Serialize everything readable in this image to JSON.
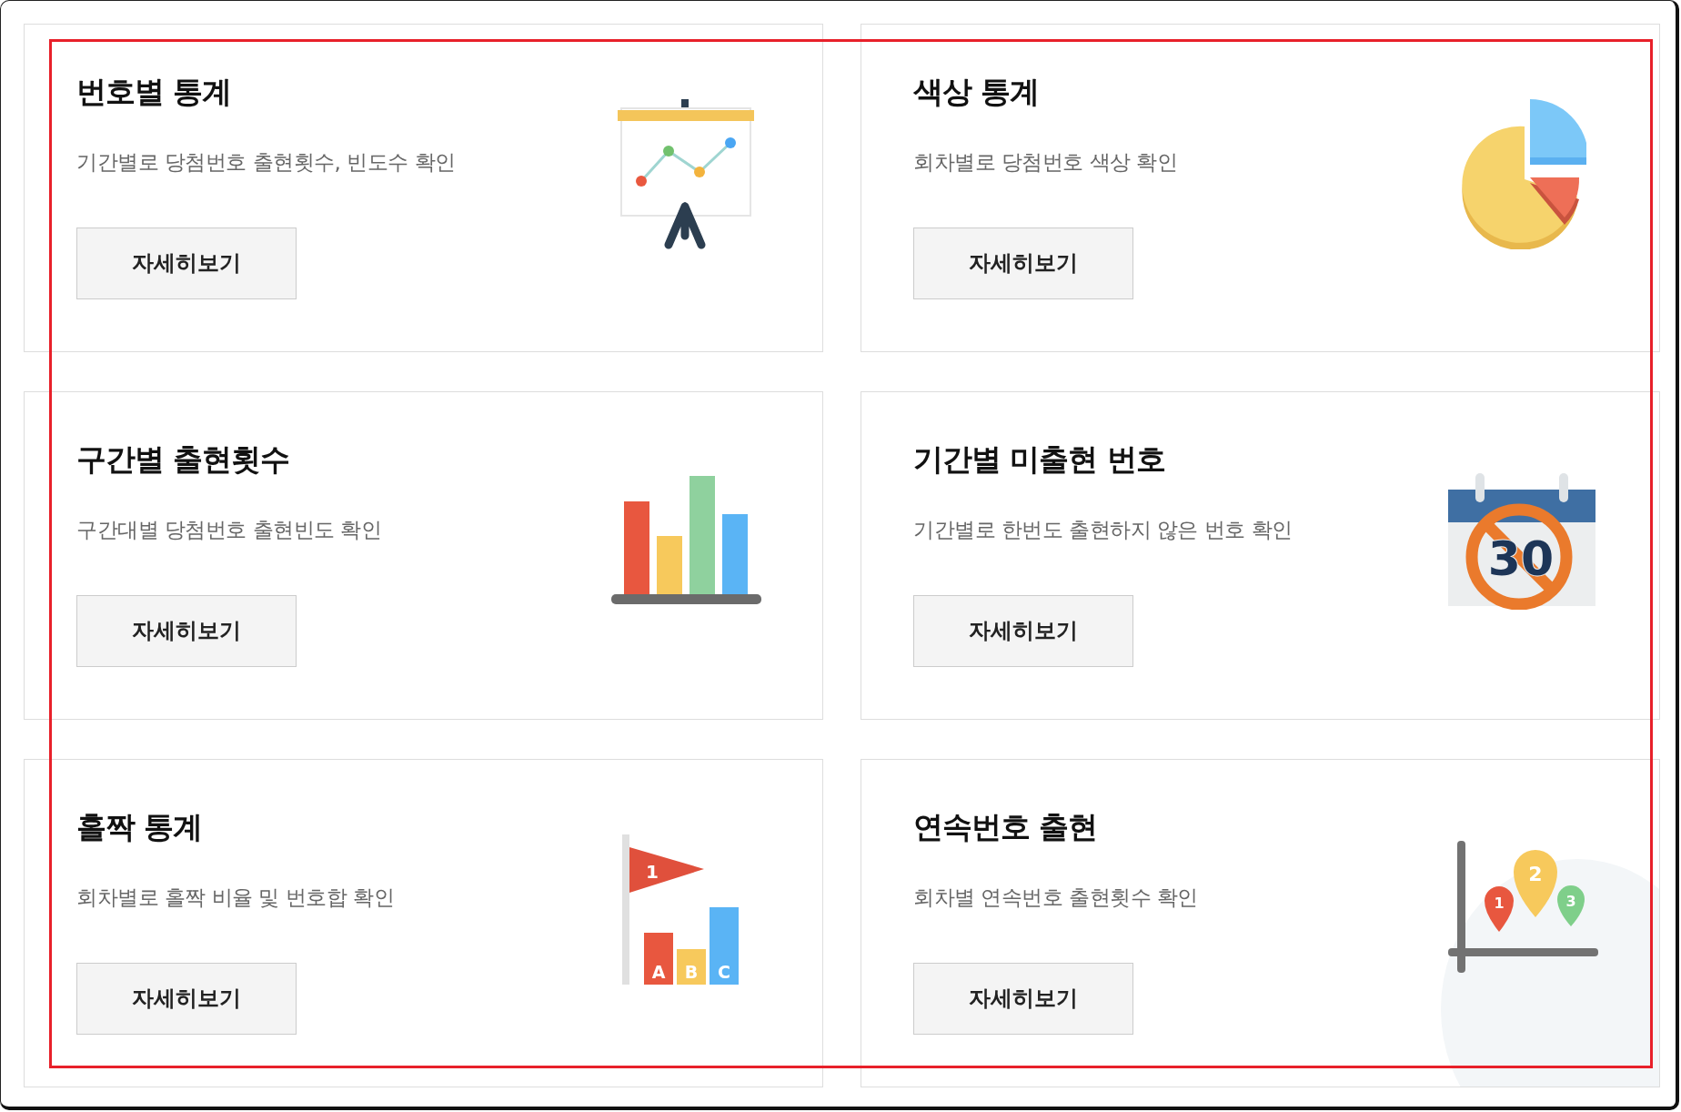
{
  "cards": [
    {
      "title": "번호별 통계",
      "description": "기간별로 당첨번호 출현횟수, 빈도수 확인",
      "button": "자세히보기",
      "icon": {
        "kind": "easel"
      }
    },
    {
      "title": "색상 통계",
      "description": "회차별로 당첨번호 색상 확인",
      "button": "자세히보기",
      "icon": {
        "kind": "pie"
      }
    },
    {
      "title": "구간별 출현횟수",
      "description": "구간대별 당첨번호 출현빈도 확인",
      "button": "자세히보기",
      "icon": {
        "kind": "bars"
      }
    },
    {
      "title": "기간별 미출현 번호",
      "description": "기간별로 한번도 출현하지 않은 번호 확인",
      "button": "자세히보기",
      "icon": {
        "kind": "calendar",
        "labels": [
          "30"
        ]
      }
    },
    {
      "title": "홀짝 통계",
      "description": "회차별로 홀짝 비율 및 번호합 확인",
      "button": "자세히보기",
      "icon": {
        "kind": "flag",
        "labels": [
          "1",
          "A",
          "B",
          "C"
        ]
      }
    },
    {
      "title": "연속번호 출현",
      "description": "회차별 연속번호 출현횟수 확인",
      "button": "자세히보기",
      "icon": {
        "kind": "pins",
        "labels": [
          "1",
          "2",
          "3"
        ]
      }
    }
  ],
  "highlight": {
    "color": "#e8202a"
  }
}
